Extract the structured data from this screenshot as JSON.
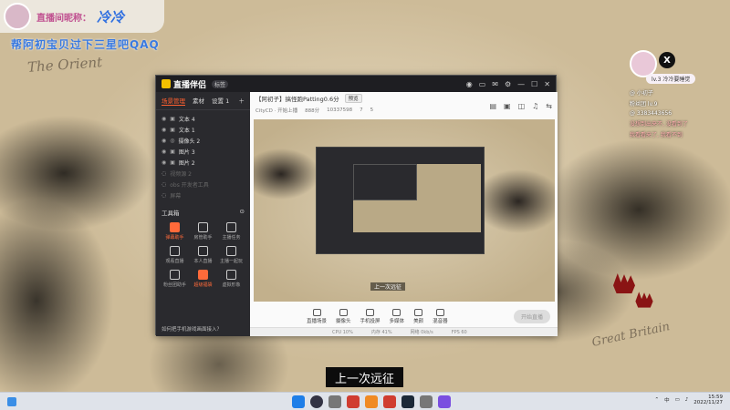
{
  "overlay": {
    "label": "直播间昵称：",
    "name": "冷冷",
    "subtitle": "帮阿初宝贝过下三星吧QAQ"
  },
  "map": {
    "orient": "The Orient",
    "britain": "Great Britain",
    "small_label": "Great Britain"
  },
  "obs_window": {
    "app_name": "直播伴侣",
    "badge": "标签",
    "title_icons": [
      "user-icon",
      "minimize-icon",
      "maximize-icon",
      "close-icon"
    ],
    "tabs": [
      "场景管理",
      "素材",
      "设置 1"
    ],
    "sources": [
      {
        "label": "文本 4",
        "dim": false
      },
      {
        "label": "文本 1",
        "dim": false
      },
      {
        "label": "摄像头 2",
        "dim": false
      },
      {
        "label": "图片 3",
        "dim": false
      },
      {
        "label": "图片 2",
        "dim": false
      },
      {
        "label": "视频源 2",
        "dim": true
      },
      {
        "label": "obs 开发者工具",
        "dim": true
      },
      {
        "label": "屏幕",
        "dim": true
      }
    ],
    "tools_title": "工具箱",
    "tools": [
      {
        "label": "弹幕助手",
        "hot": true
      },
      {
        "label": "房管助手",
        "hot": false
      },
      {
        "label": "主播任务",
        "hot": false
      },
      {
        "label": "观看直播",
        "hot": false
      },
      {
        "label": "本人直播",
        "hot": false
      },
      {
        "label": "主播一起玩",
        "hot": false
      },
      {
        "label": "粉丝团助手",
        "hot": false
      },
      {
        "label": "超级福袋",
        "hot": true
      },
      {
        "label": "虚拟形象",
        "hot": false
      }
    ],
    "footer": "如何把手机游戏画面接入？",
    "stream_title": "【阿初子】搞怪跑Patting0.6分",
    "stream_tag": "预览",
    "live_label": "CityCD · 开始上播",
    "stats": [
      "888分",
      "10337598",
      "7",
      "5"
    ],
    "preview_caption": "上一次远征",
    "controls": [
      {
        "label": "直播场景"
      },
      {
        "label": "摄像头"
      },
      {
        "label": "手机投屏"
      },
      {
        "label": "多媒体"
      },
      {
        "label": "美颜"
      },
      {
        "label": "混音器"
      }
    ],
    "go_live": "开始直播",
    "status_items": [
      "CPU 10%",
      "内存 41%",
      "网络 0kb/s",
      "FPS 60"
    ]
  },
  "chat": {
    "pill": "lv.3 冷冷要睡觉",
    "lines": [
      {
        "text": "@ 小初子",
        "pink": false
      },
      {
        "text": "粉丝团 lv.9",
        "pink": false
      },
      {
        "text": "@ 3383443656",
        "pink": false
      },
      {
        "text": "没想到出来不, 没看到了",
        "pink": true
      },
      {
        "text": "我看看来了, 我看不到",
        "pink": true
      }
    ],
    "close": "X"
  },
  "subtitle": "上一次远征",
  "taskbar": {
    "time": "15:59",
    "date": "2022/11/27",
    "lang": "中"
  }
}
